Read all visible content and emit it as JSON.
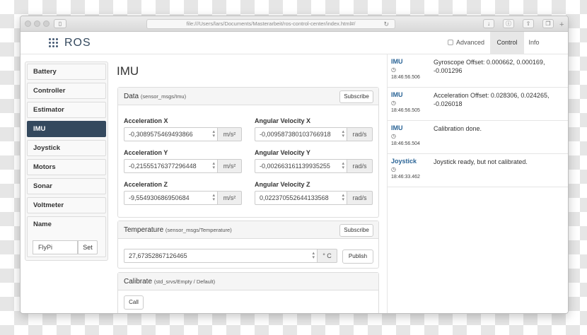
{
  "browser": {
    "url": "file:///Users/lars/Documents/Masterarbeit/ros-control-center/index.html#/",
    "reload_icon": "↻",
    "new_tab_icon": "+"
  },
  "navbar": {
    "brand": "ROS",
    "advanced_label": "Advanced",
    "tabs": [
      "Control",
      "Info"
    ]
  },
  "sidebar": {
    "items": [
      "Battery",
      "Controller",
      "Estimator",
      "IMU",
      "Joystick",
      "Motors",
      "Sonar",
      "Voltmeter",
      "Name"
    ],
    "active": "IMU",
    "name_value": "FlyPi",
    "set_label": "Set"
  },
  "main": {
    "title": "IMU",
    "data_panel": {
      "title": "Data",
      "type": "(sensor_msgs/Imu)",
      "subscribe_label": "Subscribe",
      "fields": [
        {
          "label": "Acceleration X",
          "value": "-0,3089575469493866",
          "unit": "m/s²"
        },
        {
          "label": "Angular Velocity X",
          "value": "-0,009587380103766918",
          "unit": "rad/s"
        },
        {
          "label": "Acceleration Y",
          "value": "-0,21555176377296448",
          "unit": "m/s²"
        },
        {
          "label": "Angular Velocity Y",
          "value": "-0,002663161139935255",
          "unit": "rad/s"
        },
        {
          "label": "Acceleration Z",
          "value": "-9,554930686950684",
          "unit": "m/s²"
        },
        {
          "label": "Angular Velocity Z",
          "value": "0,022370552644133568",
          "unit": "rad/s"
        }
      ]
    },
    "temperature_panel": {
      "title": "Temperature",
      "type": "(sensor_msgs/Temperature)",
      "subscribe_label": "Subscribe",
      "value": "27,67352867126465",
      "unit": "° C",
      "publish_label": "Publish"
    },
    "calibrate_panel": {
      "title": "Calibrate",
      "type": "(std_srvs/Empty / Default)",
      "call_label": "Call"
    }
  },
  "log": [
    {
      "source": "IMU",
      "time": "18:46:56.506",
      "message": "Gyroscope Offset: 0.000662, 0.000169, -0.001296"
    },
    {
      "source": "IMU",
      "time": "18:46:56.505",
      "message": "Acceleration Offset: 0.028306, 0.024265, -0.026018"
    },
    {
      "source": "IMU",
      "time": "18:46:56.504",
      "message": "Calibration done."
    },
    {
      "source": "Joystick",
      "time": "18:46:33.462",
      "message": "Joystick ready, but not calibrated."
    }
  ]
}
